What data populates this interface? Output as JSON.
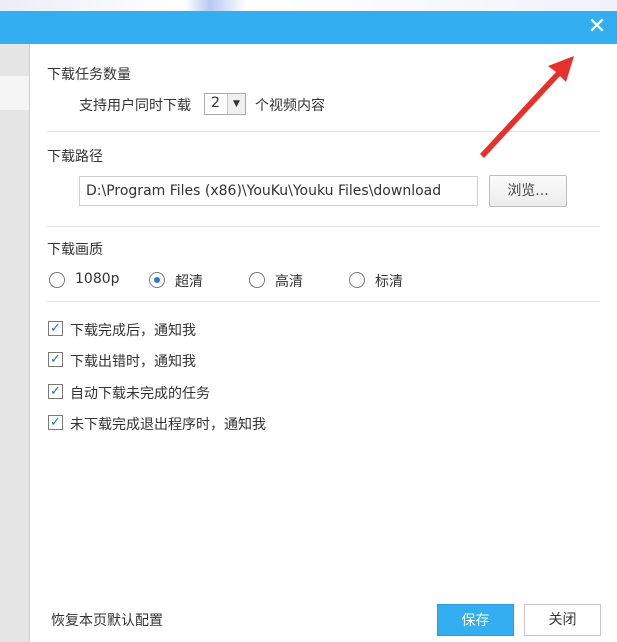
{
  "dialog": {
    "close_glyph": "✕"
  },
  "download_count": {
    "title": "下载任务数量",
    "prefix": "支持用户同时下载",
    "value": "2",
    "suffix": "个视频内容"
  },
  "download_path": {
    "title": "下载路径",
    "value": "D:\\Program Files (x86)\\YouKu\\Youku Files\\download",
    "browse_label": "浏览..."
  },
  "quality": {
    "title": "下载画质",
    "options": [
      {
        "label": "1080p",
        "selected": false
      },
      {
        "label": "超清",
        "selected": true
      },
      {
        "label": "高清",
        "selected": false
      },
      {
        "label": "标清",
        "selected": false
      }
    ]
  },
  "notifications": [
    {
      "label": "下载完成后，通知我",
      "checked": true
    },
    {
      "label": "下载出错时，通知我",
      "checked": true
    },
    {
      "label": "自动下载未完成的任务",
      "checked": true
    },
    {
      "label": "未下载完成退出程序时，通知我",
      "checked": true
    }
  ],
  "footer": {
    "restore_label": "恢复本页默认配置",
    "save_label": "保存",
    "close_label": "关闭"
  },
  "colors": {
    "accent": "#33aef1",
    "annotation_arrow": "#e8302a"
  }
}
